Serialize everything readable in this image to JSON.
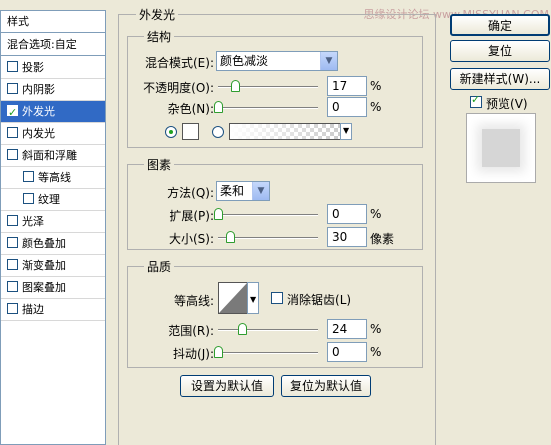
{
  "sidebar": {
    "items": [
      {
        "label": "样式",
        "type": "header"
      },
      {
        "label": "混合选项:自定",
        "type": "header"
      },
      {
        "label": "投影",
        "checked": false
      },
      {
        "label": "内阴影",
        "checked": false
      },
      {
        "label": "外发光",
        "checked": true,
        "selected": true
      },
      {
        "label": "内发光",
        "checked": false
      },
      {
        "label": "斜面和浮雕",
        "checked": false
      },
      {
        "label": "等高线",
        "checked": false,
        "sub": true
      },
      {
        "label": "纹理",
        "checked": false,
        "sub": true
      },
      {
        "label": "光泽",
        "checked": false
      },
      {
        "label": "颜色叠加",
        "checked": false
      },
      {
        "label": "渐变叠加",
        "checked": false
      },
      {
        "label": "图案叠加",
        "checked": false
      },
      {
        "label": "描边",
        "checked": false
      }
    ]
  },
  "panel": {
    "title": "外发光",
    "structure": {
      "title": "结构",
      "blend_mode_label": "混合模式",
      "blend_mode_key": "(E):",
      "blend_mode_value": "颜色减淡",
      "opacity_label": "不透明度",
      "opacity_key": "(O):",
      "opacity_value": "17",
      "noise_label": "杂色",
      "noise_key": "(N):",
      "noise_value": "0",
      "percent": "%",
      "fill_mode": "color"
    },
    "elements": {
      "title": "图素",
      "method_label": "方法",
      "method_key": "(Q):",
      "method_value": "柔和",
      "spread_label": "扩展",
      "spread_key": "(P):",
      "spread_value": "0",
      "size_label": "大小",
      "size_key": "(S):",
      "size_value": "30",
      "size_unit": "像素",
      "percent": "%"
    },
    "quality": {
      "title": "品质",
      "contour_label": "等高线:",
      "antialias_label": "消除锯齿",
      "antialias_key": "(L)",
      "antialias_checked": false,
      "range_label": "范围",
      "range_key": "(R):",
      "range_value": "24",
      "jitter_label": "抖动",
      "jitter_key": "(J):",
      "jitter_value": "0",
      "percent": "%"
    },
    "buttons": {
      "set_default": "设置为默认值",
      "reset_default": "复位为默认值"
    }
  },
  "right": {
    "ok": "确定",
    "reset": "复位",
    "new_style": "新建样式(W)...",
    "preview_label": "预览",
    "preview_key": "(V)",
    "preview_checked": true
  },
  "watermark": "思缘设计论坛 www.MISSYUAN.COM"
}
